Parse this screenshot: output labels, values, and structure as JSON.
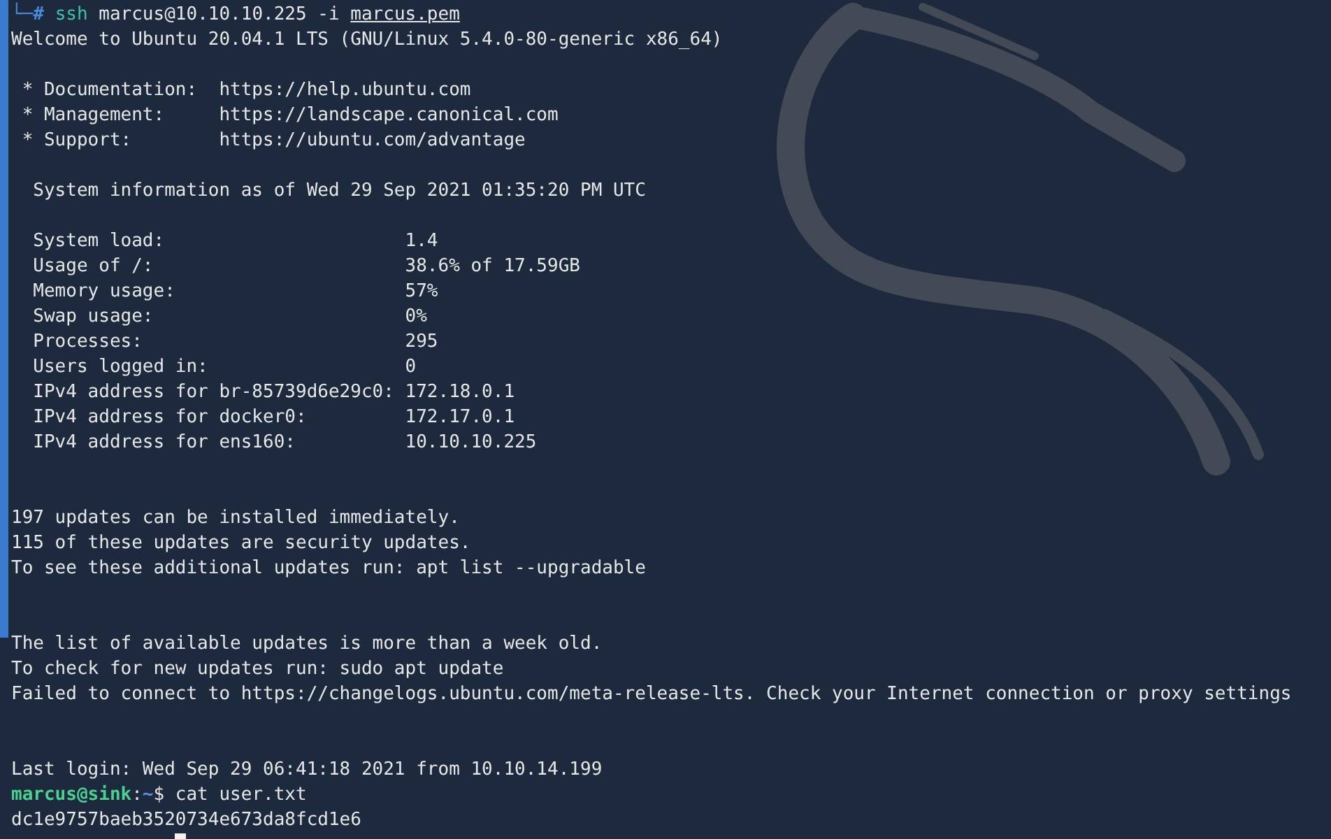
{
  "terminal": {
    "lines": [
      {
        "kind": "root_prompt",
        "symbol": "└─#",
        "command": "ssh",
        "args": "marcus@10.10.10.225 -i",
        "file": "marcus.pem"
      },
      {
        "kind": "text",
        "text": "Welcome to Ubuntu 20.04.1 LTS (GNU/Linux 5.4.0-80-generic x86_64)"
      },
      {
        "kind": "blank"
      },
      {
        "kind": "text",
        "text": " * Documentation:  https://help.ubuntu.com"
      },
      {
        "kind": "text",
        "text": " * Management:     https://landscape.canonical.com"
      },
      {
        "kind": "text",
        "text": " * Support:        https://ubuntu.com/advantage"
      },
      {
        "kind": "blank"
      },
      {
        "kind": "text",
        "text": "  System information as of Wed 29 Sep 2021 01:35:20 PM UTC"
      },
      {
        "kind": "blank"
      },
      {
        "kind": "text",
        "text": "  System load:                      1.4"
      },
      {
        "kind": "text",
        "text": "  Usage of /:                       38.6% of 17.59GB"
      },
      {
        "kind": "text",
        "text": "  Memory usage:                     57%"
      },
      {
        "kind": "text",
        "text": "  Swap usage:                       0%"
      },
      {
        "kind": "text",
        "text": "  Processes:                        295"
      },
      {
        "kind": "text",
        "text": "  Users logged in:                  0"
      },
      {
        "kind": "text",
        "text": "  IPv4 address for br-85739d6e29c0: 172.18.0.1"
      },
      {
        "kind": "text",
        "text": "  IPv4 address for docker0:         172.17.0.1"
      },
      {
        "kind": "text",
        "text": "  IPv4 address for ens160:          10.10.10.225"
      },
      {
        "kind": "blank"
      },
      {
        "kind": "blank"
      },
      {
        "kind": "text",
        "text": "197 updates can be installed immediately."
      },
      {
        "kind": "text",
        "text": "115 of these updates are security updates."
      },
      {
        "kind": "text",
        "text": "To see these additional updates run: apt list --upgradable"
      },
      {
        "kind": "blank"
      },
      {
        "kind": "blank"
      },
      {
        "kind": "text",
        "text": "The list of available updates is more than a week old."
      },
      {
        "kind": "text",
        "text": "To check for new updates run: sudo apt update"
      },
      {
        "kind": "text",
        "text": "Failed to connect to https://changelogs.ubuntu.com/meta-release-lts. Check your Internet connection or proxy settings"
      },
      {
        "kind": "blank"
      },
      {
        "kind": "blank"
      },
      {
        "kind": "text",
        "text": "Last login: Wed Sep 29 06:41:18 2021 from 10.10.14.199"
      },
      {
        "kind": "user_prompt",
        "user_host": "marcus@sink",
        "separator": ":",
        "path": "~",
        "symbol": "$",
        "command": "cat user.txt"
      },
      {
        "kind": "text",
        "text": "dc1e9757baeb3520734e673da8fcd1e6"
      }
    ],
    "cursor": true
  }
}
